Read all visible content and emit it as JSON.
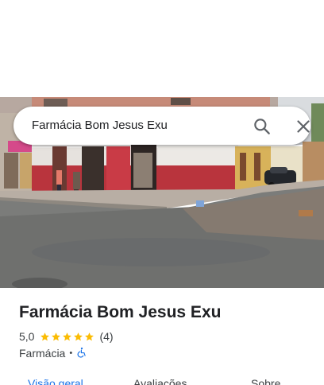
{
  "search": {
    "query": "Farmácia Bom Jesus Exu",
    "search_icon": "search-icon",
    "close_icon": "close-icon"
  },
  "photo": {
    "subject": "street-view-photo"
  },
  "place": {
    "name": "Farmácia Bom Jesus Exu",
    "rating": "5,0",
    "stars": 5,
    "review_count": "(4)",
    "category": "Farmácia",
    "separator": "•",
    "accessibility_icon": "wheelchair-accessible-icon"
  },
  "tabs": [
    {
      "label": "Visão geral",
      "active": true
    },
    {
      "label": "Avaliações",
      "active": false
    },
    {
      "label": "Sobre",
      "active": false
    }
  ],
  "colors": {
    "accent": "#1a73e8",
    "star": "#fbbc04",
    "text": "#202124",
    "secondary_text": "#3c4043"
  }
}
